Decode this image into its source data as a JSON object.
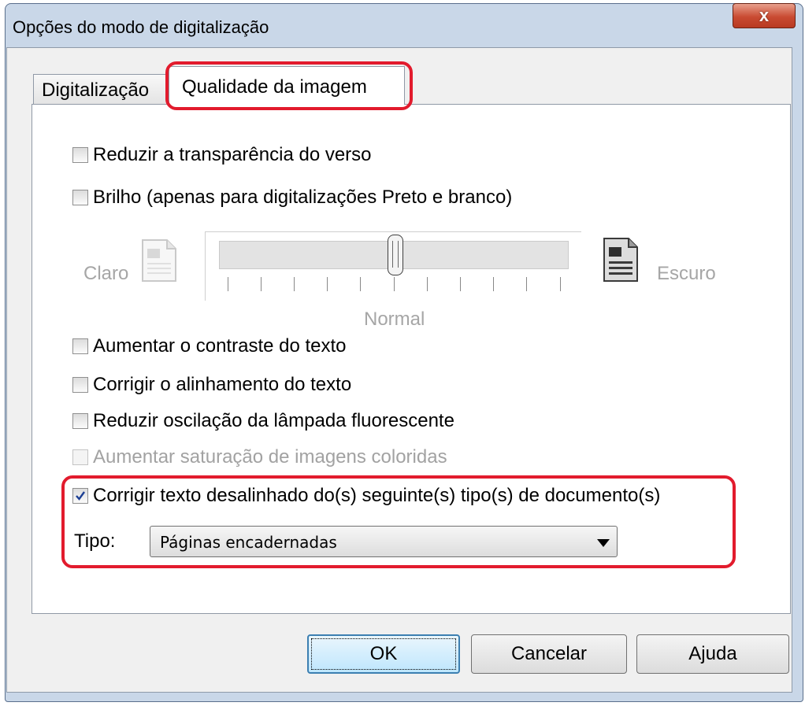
{
  "window": {
    "title": "Opções do modo de digitalização",
    "close_glyph": "x"
  },
  "tabs": [
    {
      "label": "Digitalização",
      "active": false
    },
    {
      "label": "Qualidade da imagem",
      "active": true
    }
  ],
  "options": {
    "reduce_bleed": {
      "label": "Reduzir a transparência do verso",
      "checked": false,
      "enabled": true
    },
    "brightness": {
      "label": "Brilho (apenas para digitalizações Preto e branco)",
      "checked": false,
      "enabled": true
    },
    "text_contrast": {
      "label": "Aumentar o contraste do texto",
      "checked": false,
      "enabled": true
    },
    "text_alignment": {
      "label": "Corrigir o alinhamento do texto",
      "checked": false,
      "enabled": true
    },
    "flicker": {
      "label": "Reduzir oscilação da lâmpada fluorescente",
      "checked": false,
      "enabled": true
    },
    "saturation": {
      "label": "Aumentar saturação de imagens coloridas",
      "checked": false,
      "enabled": false
    },
    "skew_correction": {
      "label": "Corrigir texto desalinhado do(s) seguinte(s) tipo(s) de documento(s)",
      "checked": true,
      "enabled": true
    }
  },
  "slider": {
    "left_label": "Claro",
    "right_label": "Escuro",
    "center_label": "Normal",
    "tick_count": 11,
    "value_index": 5,
    "enabled": false
  },
  "doc_type": {
    "label": "Tipo:",
    "selected": "Páginas encadernadas"
  },
  "buttons": {
    "ok": "OK",
    "cancel": "Cancelar",
    "help": "Ajuda"
  },
  "colors": {
    "highlight": "#e21b2d",
    "close_button": "#c94b32",
    "check_mark": "#1c3f94"
  },
  "icons": {
    "light_doc": "light-document-icon",
    "dark_doc": "dark-document-icon",
    "check": "checkmark-icon",
    "close": "close-icon",
    "dropdown": "chevron-down-icon"
  }
}
